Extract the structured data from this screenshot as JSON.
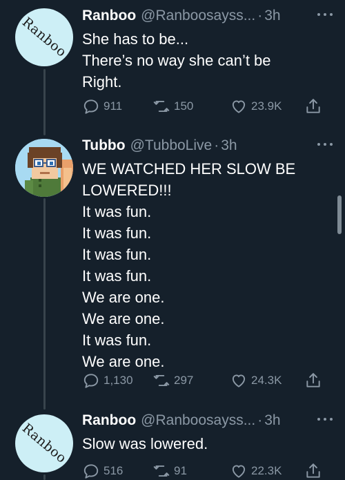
{
  "tweets": [
    {
      "avatar_text": "Ranboo",
      "name": "Ranboo",
      "handle": "@Ranboosayss...",
      "separator": "·",
      "time": "3h",
      "lines": [
        "She has to be...",
        "There’s no way she can’t be",
        "Right."
      ],
      "replies": "911",
      "retweets": "150",
      "likes": "23.9K"
    },
    {
      "avatar_text": "",
      "name": "Tubbo",
      "handle": "@TubboLive",
      "separator": "·",
      "time": "3h",
      "lines": [
        "WE WATCHED HER SLOW BE",
        "LOWERED!!!",
        "It was fun.",
        "It was fun.",
        "It was fun.",
        "It was fun.",
        "We are one.",
        "We are one.",
        "It was fun.",
        "We are one."
      ],
      "replies": "1,130",
      "retweets": "297",
      "likes": "24.3K"
    },
    {
      "avatar_text": "Ranboo",
      "name": "Ranboo",
      "handle": "@Ranboosayss...",
      "separator": "·",
      "time": "3h",
      "lines": [
        "Slow was lowered."
      ],
      "replies": "516",
      "retweets": "91",
      "likes": "22.3K"
    }
  ],
  "colors": {
    "background": "#15202b",
    "muted": "#8b98a5",
    "thread_line": "#38444d",
    "text": "#ffffff"
  }
}
